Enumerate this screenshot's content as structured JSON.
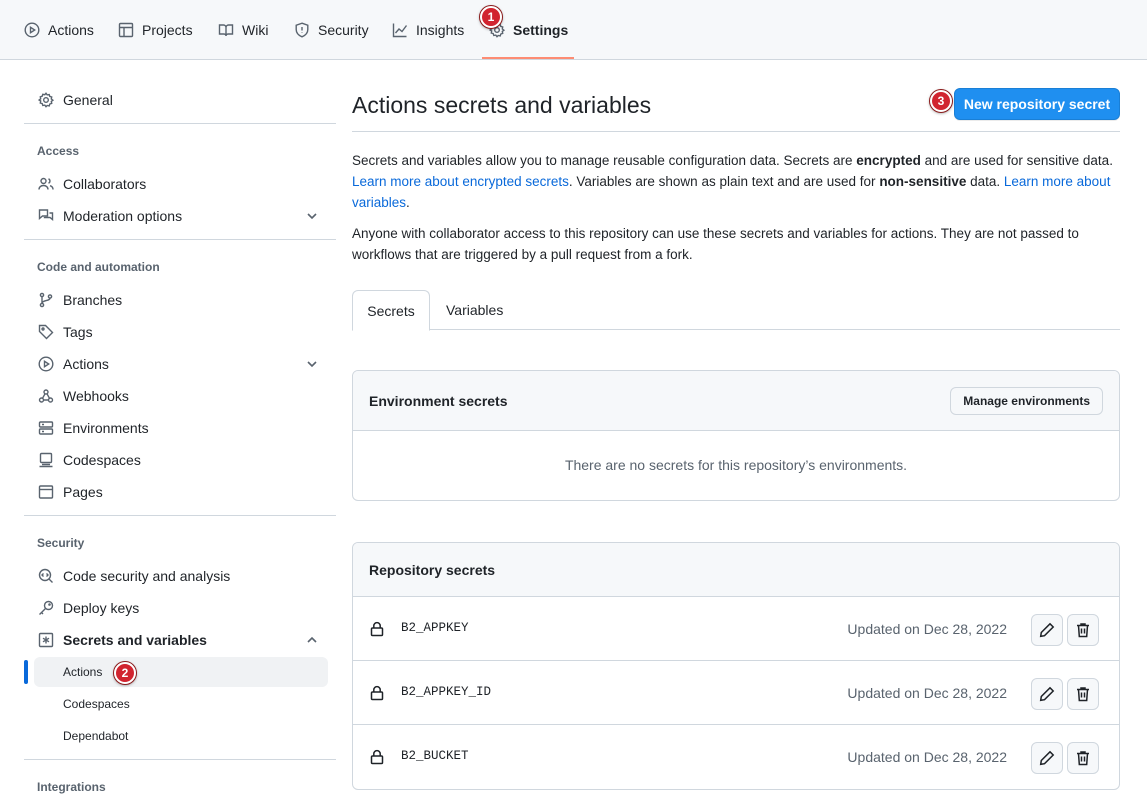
{
  "topnav": {
    "tabs": [
      {
        "label": "Actions",
        "icon": "play-circle-icon"
      },
      {
        "label": "Projects",
        "icon": "table-icon"
      },
      {
        "label": "Wiki",
        "icon": "book-icon"
      },
      {
        "label": "Security",
        "icon": "shield-icon"
      },
      {
        "label": "Insights",
        "icon": "graph-icon"
      },
      {
        "label": "Settings",
        "icon": "gear-icon",
        "active": true
      }
    ]
  },
  "annotations": {
    "step1": "1",
    "step2": "2",
    "step3": "3"
  },
  "sidebar": {
    "general": "General",
    "access_heading": "Access",
    "collaborators": "Collaborators",
    "moderation": "Moderation options",
    "code_heading": "Code and automation",
    "branches": "Branches",
    "tags": "Tags",
    "actions": "Actions",
    "webhooks": "Webhooks",
    "environments": "Environments",
    "codespaces": "Codespaces",
    "pages": "Pages",
    "security_heading": "Security",
    "code_security": "Code security and analysis",
    "deploy_keys": "Deploy keys",
    "secrets_vars": "Secrets and variables",
    "sub_actions": "Actions",
    "sub_codespaces": "Codespaces",
    "sub_dependabot": "Dependabot",
    "integrations_heading": "Integrations"
  },
  "main": {
    "title": "Actions secrets and variables",
    "new_secret_button": "New repository secret",
    "desc1": {
      "p1": "Secrets and variables allow you to manage reusable configuration data. Secrets are ",
      "b1": "encrypted",
      "p2": " and are used for sensitive data. ",
      "link1": "Learn more about encrypted secrets",
      "p3": ". Variables are shown as plain text and are used for ",
      "b2": "non-sensitive",
      "p4": " data. ",
      "link2": "Learn more about variables",
      "p5": "."
    },
    "desc2": "Anyone with collaborator access to this repository can use these secrets and variables for actions. They are not passed to workflows that are triggered by a pull request from a fork.",
    "tabs": {
      "secrets": "Secrets",
      "variables": "Variables"
    },
    "env_box": {
      "title": "Environment secrets",
      "manage_button": "Manage environments",
      "empty_text": "There are no secrets for this repository’s environments."
    },
    "repo_box": {
      "title": "Repository secrets",
      "secrets": [
        {
          "name": "B2_APPKEY",
          "updated": "Updated on Dec 28, 2022"
        },
        {
          "name": "B2_APPKEY_ID",
          "updated": "Updated on Dec 28, 2022"
        },
        {
          "name": "B2_BUCKET",
          "updated": "Updated on Dec 28, 2022"
        }
      ]
    }
  },
  "colors": {
    "primary_button": "#1f8ff0",
    "link": "#0969da",
    "active_underline": "#fd8c73",
    "badge": "#d1242f"
  }
}
